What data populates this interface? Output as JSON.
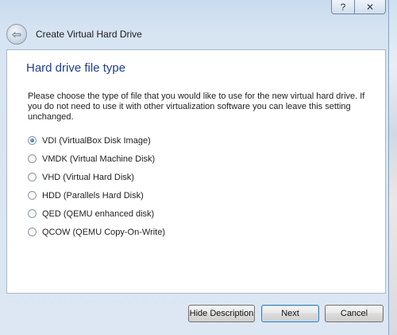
{
  "window": {
    "title": "Create Virtual Hard Drive",
    "help_glyph": "?",
    "close_glyph": "✕",
    "back_glyph": "⇦"
  },
  "page": {
    "title": "Hard drive file type",
    "description": "Please choose the type of file that you would like to use for the new virtual hard drive. If you do not need to use it with other virtualization software you can leave this setting unchanged."
  },
  "options": [
    {
      "label": "VDI (VirtualBox Disk Image)",
      "checked": true
    },
    {
      "label": "VMDK (Virtual Machine Disk)",
      "checked": false
    },
    {
      "label": "VHD (Virtual Hard Disk)",
      "checked": false
    },
    {
      "label": "HDD (Parallels Hard Disk)",
      "checked": false
    },
    {
      "label": "QED (QEMU enhanced disk)",
      "checked": false
    },
    {
      "label": "QCOW (QEMU Copy-On-Write)",
      "checked": false
    }
  ],
  "buttons": {
    "hide_description": "Hide Description",
    "next": "Next",
    "cancel": "Cancel"
  },
  "colors": {
    "title_blue": "#1f3f8f",
    "default_button_border": "#3c7fb1"
  }
}
